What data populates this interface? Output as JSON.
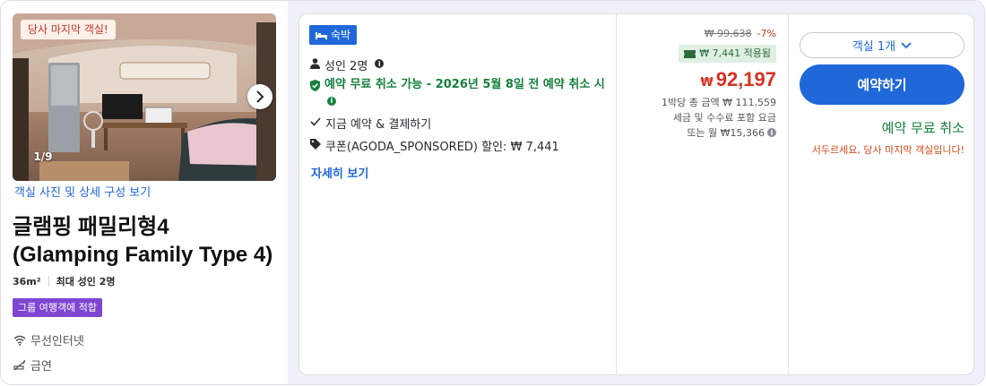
{
  "room": {
    "photo_tag": "당사 마지막 객실!",
    "photo_counter": "1/9",
    "photos_link": "객실 사진 및 상세 구성 보기",
    "title_ko": "글램핑 패밀리형4",
    "title_en": "(Glamping Family Type 4)",
    "size": "36m²",
    "max_occupancy": "최대 성인 2명",
    "group_badge": "그룹 여행객에 적합",
    "amenities": [
      {
        "icon": "wifi-icon",
        "label": "무선인터넷"
      },
      {
        "icon": "no-smoking-icon",
        "label": "금연"
      }
    ]
  },
  "offer": {
    "stay_badge": "숙박",
    "occupancy": "성인 2명",
    "free_cancel_policy": "예약 무료 취소 가능 - 2026년 5월 8일 전 예약 취소 시",
    "pay_now": "지금 예약 & 결제하기",
    "coupon_text": "쿠폰(AGODA_SPONSORED) 할인: ₩ 7,441",
    "details_link": "자세히 보기"
  },
  "price": {
    "original": "₩ 99,638",
    "discount": "-7%",
    "coupon_applied": "₩ 7,441 적용됨",
    "currency": "₩",
    "amount": "92,197",
    "per_night_total": "1박당 총 금액 ₩ 111,559",
    "tax_note": "세금 및 수수료 포함 요금",
    "monthly": "또는 월 ₩15,366"
  },
  "action": {
    "room_select": "객실 1개",
    "book_button": "예약하기",
    "free_cancel": "예약 무료 취소",
    "hurry_note": "서두르세요, 당사 마지막 객실입니다!"
  },
  "colors": {
    "brand_blue": "#2067da",
    "price_red": "#d63125",
    "success_green": "#15803d",
    "badge_purple": "#7e46d1",
    "warning_orange": "#d04a1a"
  }
}
